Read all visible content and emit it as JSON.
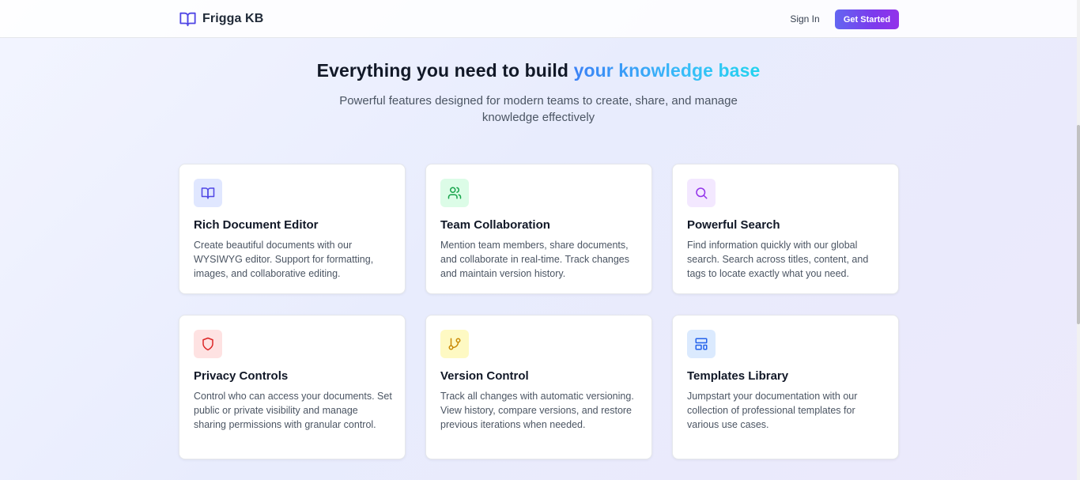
{
  "header": {
    "brand_name": "Frigga KB",
    "sign_in_label": "Sign In",
    "get_started_label": "Get Started"
  },
  "hero": {
    "title_main": "Everything you need to build ",
    "title_accent": "your knowledge base",
    "subtitle": "Powerful features designed for modern teams to create, share, and manage knowledge effectively"
  },
  "features": [
    {
      "icon": "book-open-icon",
      "color": "#4f46e5",
      "bg": "#e0e7ff",
      "title": "Rich Document Editor",
      "description": "Create beautiful documents with our WYSIWYG editor. Support for formatting, images, and collaborative editing."
    },
    {
      "icon": "users-icon",
      "color": "#16a34a",
      "bg": "#dcfce7",
      "title": "Team Collaboration",
      "description": "Mention team members, share documents, and collaborate in real-time. Track changes and maintain version history."
    },
    {
      "icon": "search-icon",
      "color": "#9333ea",
      "bg": "#f3e8ff",
      "title": "Powerful Search",
      "description": "Find information quickly with our global search. Search across titles, content, and tags to locate exactly what you need."
    },
    {
      "icon": "shield-icon",
      "color": "#dc2626",
      "bg": "#fee2e2",
      "title": "Privacy Controls",
      "description": "Control who can access your documents. Set public or private visibility and manage sharing permissions with granular control."
    },
    {
      "icon": "git-branch-icon",
      "color": "#ca8a04",
      "bg": "#fef9c3",
      "title": "Version Control",
      "description": "Track all changes with automatic versioning. View history, compare versions, and restore previous iterations when needed."
    },
    {
      "icon": "layout-template-icon",
      "color": "#2563eb",
      "bg": "#dbeafe",
      "title": "Templates Library",
      "description": "Jumpstart your documentation with our collection of professional templates for various use cases."
    }
  ]
}
